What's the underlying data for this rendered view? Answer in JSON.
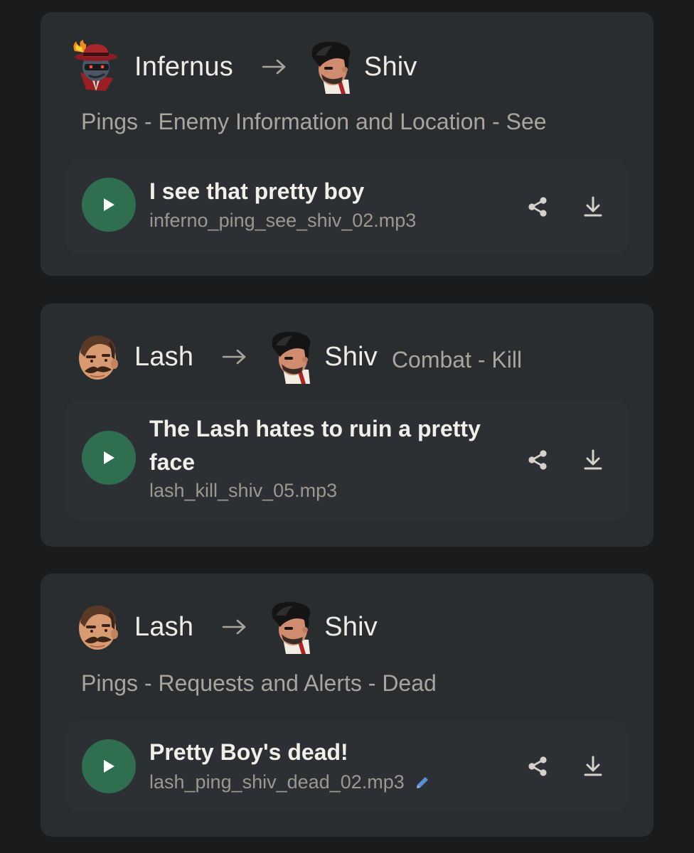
{
  "colors": {
    "background": "#1a1b1d",
    "card": "#2a2d30",
    "play_button": "#2f6e4f",
    "edit_icon": "#5b8fd4"
  },
  "cards": [
    {
      "speaker": {
        "name": "Infernus",
        "avatar_icon": "infernus-avatar-icon"
      },
      "target": {
        "name": "Shiv",
        "avatar_icon": "shiv-avatar-icon"
      },
      "category": "Pings - Enemy Information and Location - See",
      "line": {
        "quote": "I see that pretty boy",
        "filename": "inferno_ping_see_shiv_02.mp3"
      }
    },
    {
      "speaker": {
        "name": "Lash",
        "avatar_icon": "lash-avatar-icon"
      },
      "target": {
        "name": "Shiv",
        "avatar_icon": "shiv-avatar-icon"
      },
      "category": "Combat - Kill",
      "line": {
        "quote": "The Lash hates to ruin a pretty face",
        "filename": "lash_kill_shiv_05.mp3"
      }
    },
    {
      "speaker": {
        "name": "Lash",
        "avatar_icon": "lash-avatar-icon"
      },
      "target": {
        "name": "Shiv",
        "avatar_icon": "shiv-avatar-icon"
      },
      "category": "Pings - Requests and Alerts - Dead",
      "line": {
        "quote": "Pretty Boy's dead!",
        "filename": "lash_ping_shiv_dead_02.mp3",
        "edit_icon": "pencil-icon"
      }
    }
  ]
}
